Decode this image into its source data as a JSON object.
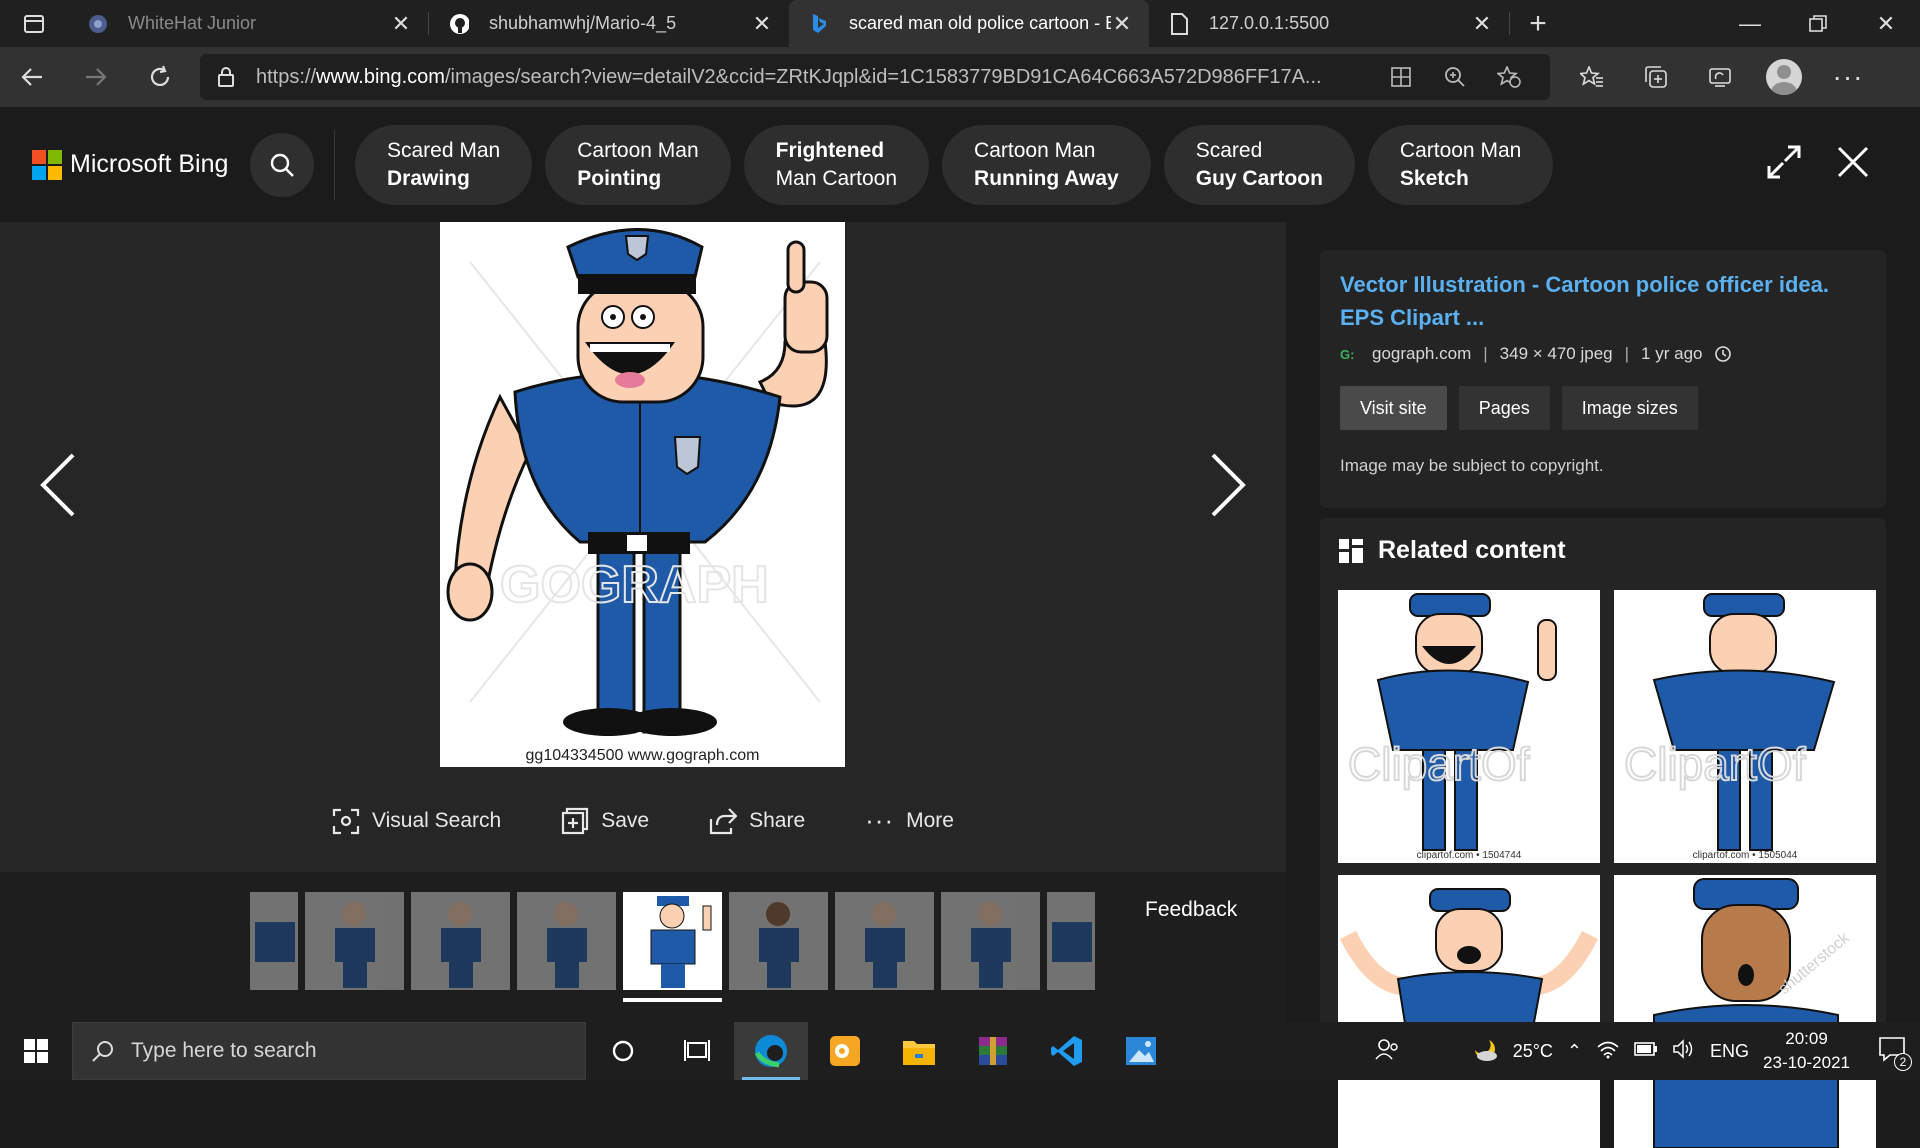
{
  "tabs": [
    {
      "title": "WhiteHat Junior",
      "favicon": "whitehat-icon",
      "state": "inactive"
    },
    {
      "title": "shubhamwhj/Mario-4_5",
      "favicon": "github-icon",
      "state": "inactive"
    },
    {
      "title": "scared man old police cartoon - B",
      "favicon": "bing-icon",
      "state": "active"
    },
    {
      "title": "127.0.0.1:5500",
      "favicon": "page-icon",
      "state": "inactive"
    }
  ],
  "address_bar": {
    "url_prefix": "https://",
    "url_host": "www.bing.com",
    "url_path": "/images/search?view=detailV2&ccid=ZRtKJqpl&id=1C1583779BD91CA64C663A572D986FF17A..."
  },
  "bing": {
    "brand": "Microsoft Bing",
    "related_searches": [
      {
        "line1": "Scared Man",
        "line2": "Drawing"
      },
      {
        "line1": "Cartoon Man",
        "line2": "Pointing"
      },
      {
        "line1": "Frightened",
        "line2": "Man Cartoon"
      },
      {
        "line1": "Cartoon Man",
        "line2": "Running Away"
      },
      {
        "line1": "Scared",
        "line2": "Guy Cartoon"
      },
      {
        "line1": "Cartoon Man",
        "line2": "Sketch"
      }
    ]
  },
  "viewer": {
    "watermark": "GOGRAPH",
    "caption": "gg104334500  www.gograph.com",
    "actions": {
      "visual_search": "Visual Search",
      "save": "Save",
      "share": "Share",
      "more": "More"
    },
    "feedback": "Feedback"
  },
  "info": {
    "title": "Vector Illustration - Cartoon police officer idea. EPS Clipart ...",
    "source": "gograph.com",
    "dimensions": "349 × 470 jpeg",
    "age": "1 yr ago",
    "buttons": {
      "visit": "Visit site",
      "pages": "Pages",
      "sizes": "Image sizes"
    },
    "copyright": "Image may be subject to copyright."
  },
  "related": {
    "title": "Related content",
    "items": [
      {
        "caption": "clipartof.com  •  1504744",
        "watermark": "ClipartOf"
      },
      {
        "caption": "clipartof.com  •  1505044",
        "watermark": "ClipartOf"
      },
      {
        "caption": "",
        "watermark": ""
      },
      {
        "caption": "",
        "watermark": "shutterstock"
      }
    ]
  },
  "taskbar": {
    "search_placeholder": "Type here to search",
    "weather": "25°C",
    "language": "ENG",
    "time": "20:09",
    "date": "23-10-2021",
    "notifications": "2"
  },
  "colors": {
    "accent_link": "#5ab0f0",
    "police_blue": "#1e5aa8",
    "skin": "#fcd1b3"
  }
}
